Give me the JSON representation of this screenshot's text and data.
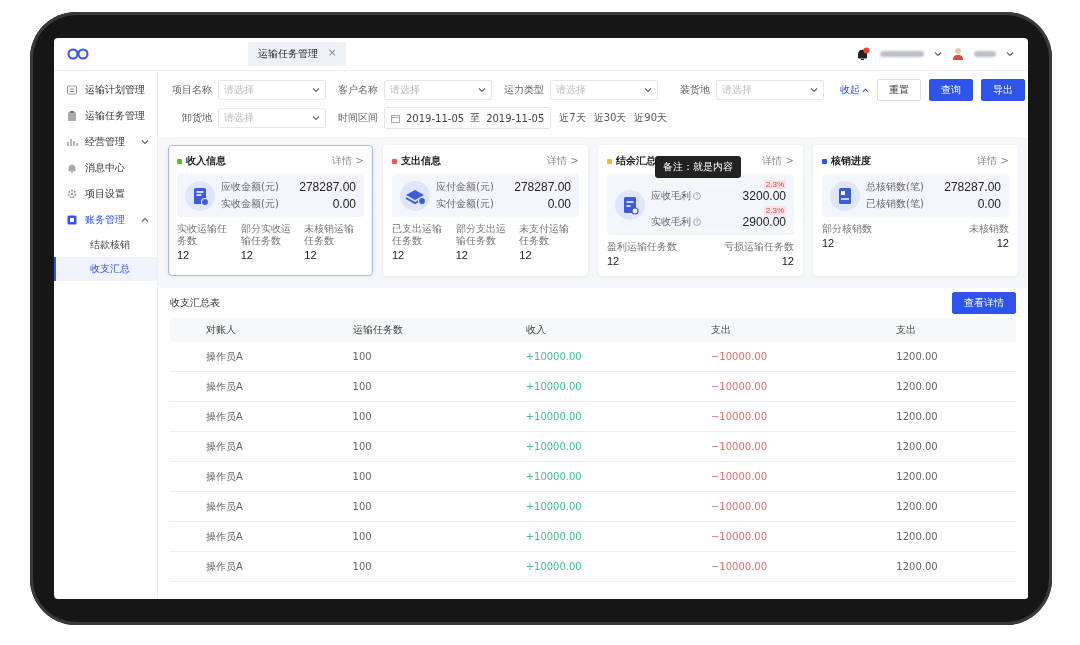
{
  "tabs": [
    {
      "label": "运输任务管理",
      "selected": true,
      "close": "×"
    }
  ],
  "sidebar": {
    "items": [
      {
        "label": "运输计划管理",
        "selected": false
      },
      {
        "label": "运输任务管理",
        "selected": false
      },
      {
        "label": "经营管理",
        "selected": false,
        "expanded": false
      },
      {
        "label": "消息中心",
        "selected": false
      },
      {
        "label": "项目设置",
        "selected": false
      },
      {
        "label": "账务管理",
        "selected": true,
        "expanded": true,
        "children": [
          {
            "label": "结款核销",
            "selected": false
          },
          {
            "label": "收支汇总",
            "selected": true
          }
        ]
      }
    ]
  },
  "filters": {
    "rows": [
      [
        {
          "kind": "select",
          "label": "项目名称",
          "placeholder": "请选择"
        },
        {
          "kind": "select",
          "label": "客户名称",
          "placeholder": "请选择"
        },
        {
          "kind": "select",
          "label": "运力类型",
          "placeholder": "请选择"
        },
        {
          "kind": "select",
          "label": "装货地",
          "placeholder": "请选择"
        }
      ],
      [
        {
          "kind": "select",
          "label": "卸货地",
          "placeholder": "请选择"
        },
        {
          "kind": "date_range",
          "label": "时间区间",
          "start": "2019-11-05",
          "separator": "至",
          "end": "2019-11-05",
          "shortcuts": [
            "近7天",
            "近30天",
            "近90天"
          ]
        }
      ]
    ],
    "collapse": "收起",
    "buttons": [
      {
        "label": "重置",
        "kind": "default"
      },
      {
        "label": "查询",
        "kind": "primary"
      },
      {
        "label": "导出",
        "kind": "primary"
      }
    ]
  },
  "cards": [
    {
      "title": "收入信息",
      "color": "#52c41a",
      "link": "详情 >",
      "selected": true,
      "metrics": [
        {
          "label": "应收金额(元)",
          "value": "278287.00"
        },
        {
          "label": "实收金额(元)",
          "value": "0.00"
        }
      ],
      "stats": [
        {
          "label": "实收运输任务数",
          "value": "12"
        },
        {
          "label": "部分实收运输任务数",
          "value": "12"
        },
        {
          "label": "未核销运输任务数",
          "value": "12"
        }
      ]
    },
    {
      "title": "支出信息",
      "color": "#f5584a",
      "link": "详情 >",
      "selected": false,
      "metrics": [
        {
          "label": "应付金额(元)",
          "value": "278287.00"
        },
        {
          "label": "实付金额(元)",
          "value": "0.00"
        }
      ],
      "stats": [
        {
          "label": "已支出运输任务数",
          "value": "12"
        },
        {
          "label": "部分支出运输任务数",
          "value": "12"
        },
        {
          "label": "未支付运输任务数",
          "value": "12"
        }
      ]
    },
    {
      "title": "结余汇总",
      "color": "#f5b82e",
      "link": "详情 >",
      "selected": false,
      "tooltip": "备注：就是内容",
      "metrics": [
        {
          "label": "应收毛利",
          "hint": true,
          "badge": "2.3%",
          "value": "3200.00"
        },
        {
          "label": "实收毛利",
          "hint": true,
          "badge": "2.3%",
          "value": "2900.00"
        }
      ],
      "stats": [
        {
          "label": "盈利运输任务数",
          "value": "12"
        },
        {
          "label": "亏损运输任务数",
          "value": "12"
        }
      ]
    },
    {
      "title": "核销进度",
      "color": "#2f54eb",
      "link": "详情 >",
      "selected": false,
      "metrics": [
        {
          "label": "总核销数(笔)",
          "value": "278287.00"
        },
        {
          "label": "已核销数(笔)",
          "value": "0.00"
        }
      ],
      "stats": [
        {
          "label": "部分核销数",
          "value": "12"
        },
        {
          "label": "未核销数",
          "value": "12"
        }
      ]
    }
  ],
  "table": {
    "title": "收支汇总表",
    "button": "查看详情",
    "columns": [
      {
        "label": "对账人",
        "kind": "text"
      },
      {
        "label": "运输任务数",
        "kind": "text"
      },
      {
        "label": "收入",
        "kind": "positive"
      },
      {
        "label": "支出",
        "kind": "negative"
      },
      {
        "label": "支出",
        "kind": "text"
      }
    ],
    "rows": [
      {
        "cells": [
          "操作员A",
          "100",
          "+10000.00",
          "−10000.00",
          "1200.00"
        ]
      },
      {
        "cells": [
          "操作员A",
          "100",
          "+10000.00",
          "−10000.00",
          "1200.00"
        ]
      },
      {
        "cells": [
          "操作员A",
          "100",
          "+10000.00",
          "−10000.00",
          "1200.00"
        ]
      },
      {
        "cells": [
          "操作员A",
          "100",
          "+10000.00",
          "−10000.00",
          "1200.00"
        ]
      },
      {
        "cells": [
          "操作员A",
          "100",
          "+10000.00",
          "−10000.00",
          "1200.00"
        ]
      },
      {
        "cells": [
          "操作员A",
          "100",
          "+10000.00",
          "−10000.00",
          "1200.00"
        ]
      },
      {
        "cells": [
          "操作员A",
          "100",
          "+10000.00",
          "−10000.00",
          "1200.00"
        ]
      },
      {
        "cells": [
          "操作员A",
          "100",
          "+10000.00",
          "−10000.00",
          "1200.00"
        ]
      }
    ]
  }
}
